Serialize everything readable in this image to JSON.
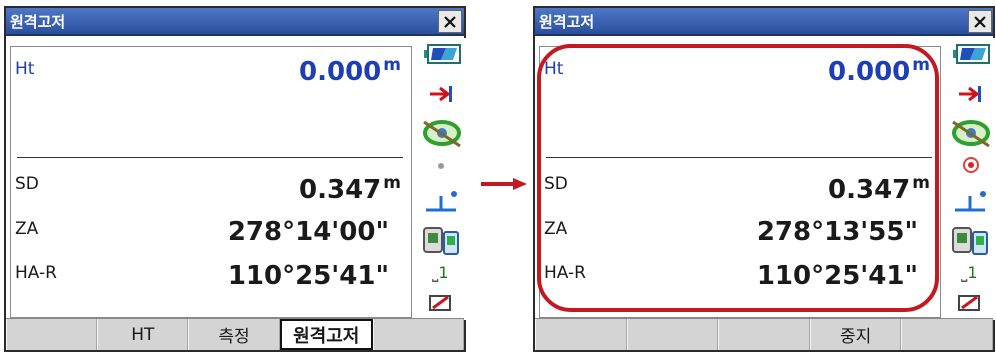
{
  "colors": {
    "accent_value": "#1d3fb3",
    "highlight": "#c31920",
    "title_bar": "#3a62b4"
  },
  "left": {
    "title": "원격고저",
    "close": "×",
    "ht_label": "Ht",
    "ht_value": "0.000",
    "ht_unit": "m",
    "sd_label": "SD",
    "sd_value": "0.347",
    "sd_unit": "m",
    "za_label": "ZA",
    "za_value": "278°14'00\"",
    "har_label": "HA-R",
    "har_value": "110°25'41\"",
    "prism_const": "1",
    "softkeys": [
      "",
      "HT",
      "측정",
      "원격고저",
      ""
    ]
  },
  "right": {
    "title": "원격고저",
    "close": "×",
    "ht_label": "Ht",
    "ht_value": "0.000",
    "ht_unit": "m",
    "sd_label": "SD",
    "sd_value": "0.347",
    "sd_unit": "m",
    "za_label": "ZA",
    "za_value": "278°13'55\"",
    "har_label": "HA-R",
    "har_value": "110°25'41\"",
    "prism_const": "1",
    "softkeys": [
      "",
      "",
      "",
      "중지",
      ""
    ]
  },
  "icons": [
    "battery-icon",
    "target-arrow-icon",
    "tilt-level-icon",
    "laser-pointer-icon",
    "prism-reflector-icon",
    "controller-link-icon",
    "prism-constant-icon",
    "input-mode-icon",
    "close-icon",
    "right-arrow-icon"
  ]
}
